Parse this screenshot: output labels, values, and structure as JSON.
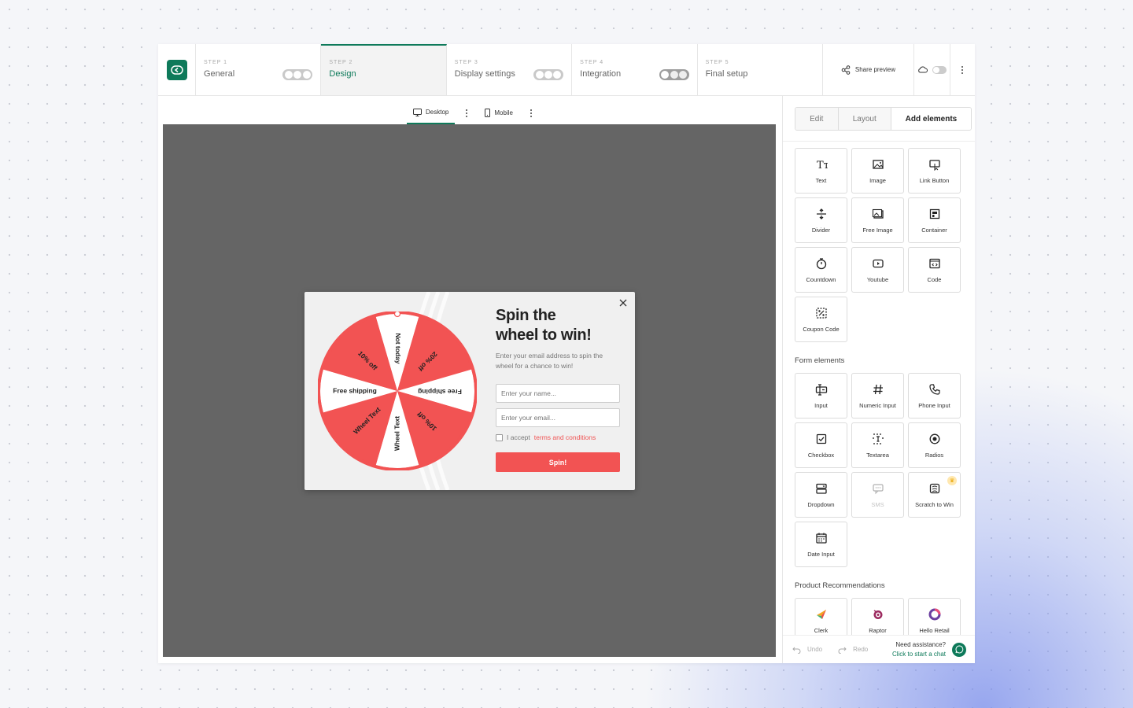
{
  "steps": [
    {
      "kicker": "STEP 1",
      "label": "General"
    },
    {
      "kicker": "STEP 2",
      "label": "Design"
    },
    {
      "kicker": "STEP 3",
      "label": "Display settings"
    },
    {
      "kicker": "STEP 4",
      "label": "Integration"
    },
    {
      "kicker": "STEP 5",
      "label": "Final setup"
    }
  ],
  "topbar": {
    "share_label": "Share preview"
  },
  "device": {
    "desktop_label": "Desktop",
    "mobile_label": "Mobile"
  },
  "popup": {
    "title_line1": "Spin the",
    "title_line2": "wheel to win!",
    "subtitle": "Enter your email address to spin the wheel for a chance to win!",
    "name_placeholder": "Enter your name...",
    "email_placeholder": "Enter your email...",
    "terms_prefix": "I accept",
    "terms_link": "terms and conditions",
    "spin_label": "Spin!",
    "wheel_segments": [
      "Not today",
      "20% off",
      "Free shipping",
      "10% off",
      "Wheel Text",
      "Wheel Text",
      "Free shipping",
      "10% off"
    ],
    "colors": {
      "wheel_red": "#f25353",
      "wheel_white": "#ffffff",
      "button": "#f25353"
    }
  },
  "panel": {
    "tabs": [
      "Edit",
      "Layout",
      "Add elements"
    ],
    "elements": [
      {
        "label": "Text",
        "icon": "text-icon"
      },
      {
        "label": "Image",
        "icon": "image-icon"
      },
      {
        "label": "Link Button",
        "icon": "link-button-icon"
      },
      {
        "label": "Divider",
        "icon": "divider-icon"
      },
      {
        "label": "Free Image",
        "icon": "free-image-icon"
      },
      {
        "label": "Container",
        "icon": "container-icon"
      },
      {
        "label": "Countdown",
        "icon": "countdown-icon"
      },
      {
        "label": "Youtube",
        "icon": "youtube-icon"
      },
      {
        "label": "Code",
        "icon": "code-icon"
      },
      {
        "label": "Coupon Code",
        "icon": "coupon-icon"
      }
    ],
    "form_title": "Form elements",
    "form_elements": [
      {
        "label": "Input",
        "icon": "input-icon"
      },
      {
        "label": "Numeric Input",
        "icon": "hash-icon"
      },
      {
        "label": "Phone Input",
        "icon": "phone-icon"
      },
      {
        "label": "Checkbox",
        "icon": "checkbox-icon"
      },
      {
        "label": "Textarea",
        "icon": "textarea-icon"
      },
      {
        "label": "Radios",
        "icon": "radio-icon"
      },
      {
        "label": "Dropdown",
        "icon": "dropdown-icon"
      },
      {
        "label": "SMS",
        "icon": "sms-icon",
        "disabled": true
      },
      {
        "label": "Scratch to Win",
        "icon": "scratch-icon",
        "premium": true
      },
      {
        "label": "Date Input",
        "icon": "calendar-icon"
      }
    ],
    "product_title": "Product Recommendations",
    "product_elements": [
      {
        "label": "Clerk",
        "icon": "clerk-icon"
      },
      {
        "label": "Raptor",
        "icon": "raptor-icon"
      },
      {
        "label": "Hello Retail",
        "icon": "hello-retail-icon"
      }
    ],
    "footer": {
      "undo": "Undo",
      "redo": "Redo",
      "help_question": "Need assistance?",
      "help_link": "Click to start a chat"
    }
  },
  "colors": {
    "brand": "#0e7a5a",
    "stage": "#656565"
  }
}
